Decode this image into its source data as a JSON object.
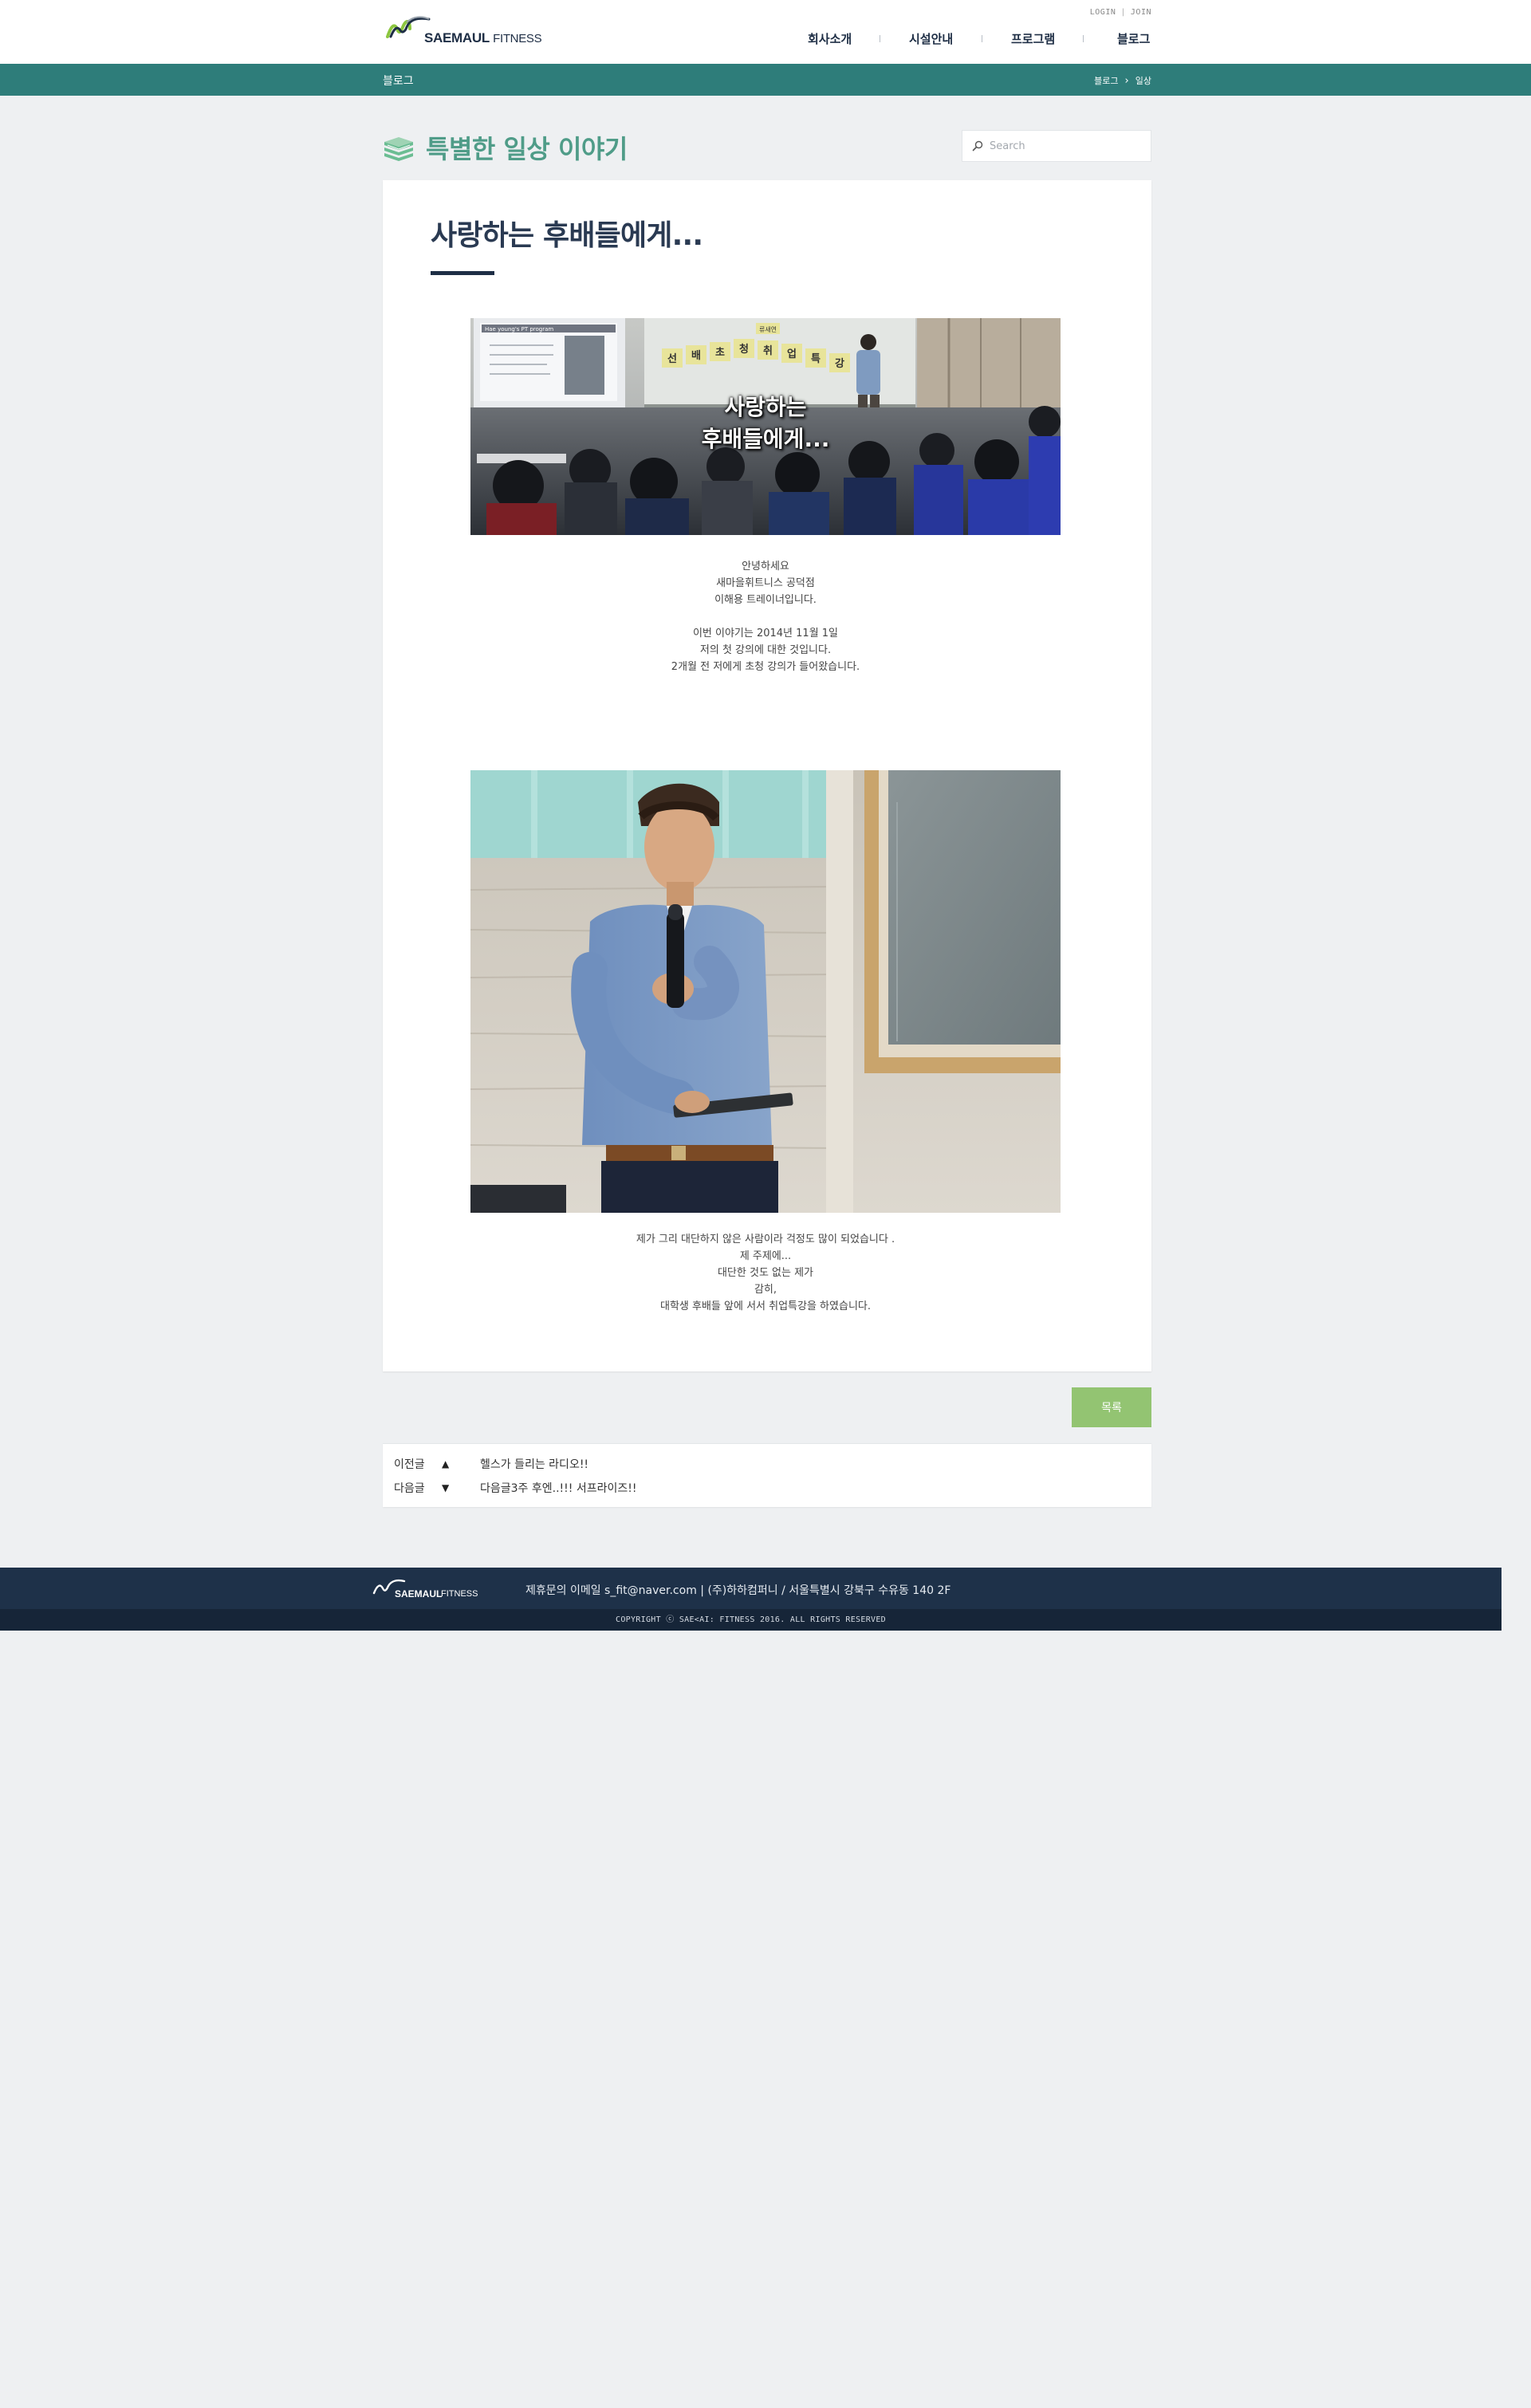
{
  "header": {
    "logo": {
      "brand": "SAEMAUL",
      "sub": "FITNESS"
    },
    "util": {
      "login": "LOGIN",
      "join": "JOIN",
      "separator": "|"
    },
    "nav": [
      {
        "label": "회사소개"
      },
      {
        "label": "시설안내"
      },
      {
        "label": "프로그램"
      },
      {
        "label": "블로그"
      }
    ]
  },
  "subbar": {
    "category": "블로그",
    "breadcrumb": [
      "블로그",
      "일상"
    ]
  },
  "page": {
    "title": "특별한 일상 이야기",
    "search_placeholder": "Search"
  },
  "post": {
    "title": "사랑하는 후배들에게...",
    "image1": {
      "caption_line1": "사랑하는",
      "caption_line2": "후배들에게...",
      "banner": [
        "선",
        "배",
        "초",
        "청",
        "취",
        "업",
        "특",
        "강"
      ],
      "banner_top": "류새연",
      "slide_title": "Hae young's PT program"
    },
    "paragraph1": [
      "안녕하세요",
      "새마을휘트니스 공덕점",
      "이해용 트레이너입니다.",
      "",
      "이번 이야기는 2014년 11월 1일",
      "저의 첫 강의에 대한 것입니다.",
      "2개월 전 저에게 초청 강의가 들어왔습니다."
    ],
    "paragraph2": [
      "제가 그리 대단하지 않은 사람이라 걱정도 많이 되었습니다 .",
      "제 주제에...",
      "대단한 것도 없는 제가",
      "감히,",
      "대학생 후배들 앞에 서서 취업특강을 하였습니다."
    ]
  },
  "list_button": "목록",
  "post_nav": {
    "prev": {
      "label": "이전글",
      "arrow": "▲",
      "title": "헬스가 들리는 라디오!!"
    },
    "next": {
      "label": "다음글",
      "arrow": "▼",
      "title": "다음글3주 후엔..!!! 서프라이즈!!"
    }
  },
  "footer": {
    "logo": {
      "brand": "SAEMAUL",
      "sub": "FITNESS"
    },
    "info": "제휴문의 이메일 s_fit@naver.com  |  (주)하하컴퍼니 / 서울특별시 강북구 수유동 140 2F",
    "copyright": "COPYRIGHT ⓒ SAE<AI: FITNESS 2016. ALL RIGHTS RESERVED"
  },
  "colors": {
    "teal_bar": "#2e7d7a",
    "title_green": "#4f9c88",
    "navy": "#1e2e45",
    "button_green": "#93c472",
    "footer_navy": "#1e3149"
  }
}
